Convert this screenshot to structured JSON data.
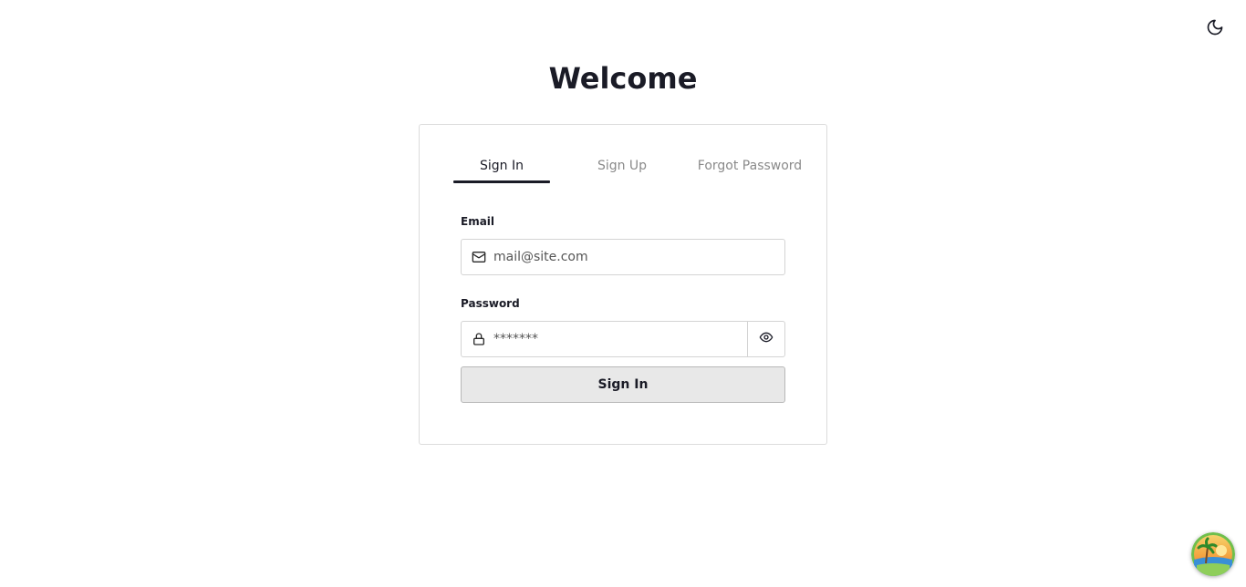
{
  "header": {
    "theme_toggle_icon": "moon-icon",
    "title": "Welcome"
  },
  "tabs": [
    {
      "label": "Sign In",
      "active": true
    },
    {
      "label": "Sign Up",
      "active": false
    },
    {
      "label": "Forgot Password",
      "active": false
    }
  ],
  "form": {
    "email": {
      "label": "Email",
      "icon": "mail-icon",
      "value": "",
      "placeholder": "mail@site.com"
    },
    "password": {
      "label": "Password",
      "icon": "lock-icon",
      "value": "",
      "placeholder": "*******",
      "toggle_icon": "eye-icon"
    },
    "submit_label": "Sign In"
  },
  "floating_avatar": {
    "icon": "palm-tree-sunset-icon"
  },
  "colors": {
    "text": "#1a1b26",
    "muted_tab": "#8a8a8a",
    "border": "#d4d4d4",
    "button_bg": "#e8e8e8"
  }
}
